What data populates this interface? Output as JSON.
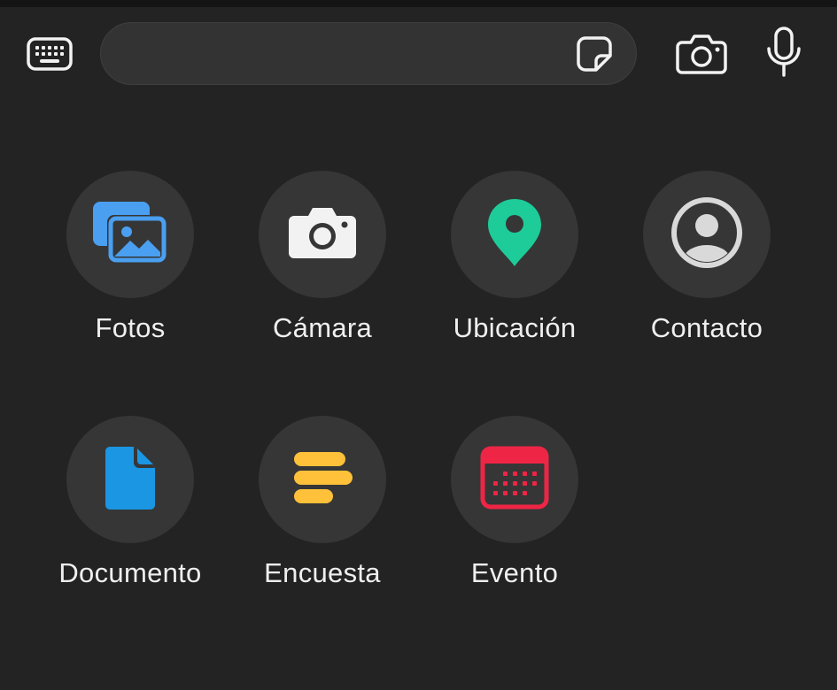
{
  "composer": {
    "message_value": "",
    "keyboard_icon": "keyboard-icon",
    "sticker_icon": "sticker-icon",
    "camera_icon": "camera-outline-icon",
    "mic_icon": "microphone-icon"
  },
  "attachments": [
    {
      "label": "Fotos",
      "icon": "photos-icon",
      "color": "#4a9ff0"
    },
    {
      "label": "Cámara",
      "icon": "camera-icon",
      "color": "#f2f2f2"
    },
    {
      "label": "Ubicación",
      "icon": "location-pin-icon",
      "color": "#1dcc98"
    },
    {
      "label": "Contacto",
      "icon": "contact-icon",
      "color": "#d9d9d9"
    },
    {
      "label": "Documento",
      "icon": "document-icon",
      "color": "#1a96e3"
    },
    {
      "label": "Encuesta",
      "icon": "poll-icon",
      "color": "#ffc13a"
    },
    {
      "label": "Evento",
      "icon": "calendar-event-icon",
      "color": "#ef2545"
    }
  ],
  "colors": {
    "background": "#232323",
    "circle": "#363636",
    "field": "#333333",
    "icon_light": "#f2f2f2"
  }
}
